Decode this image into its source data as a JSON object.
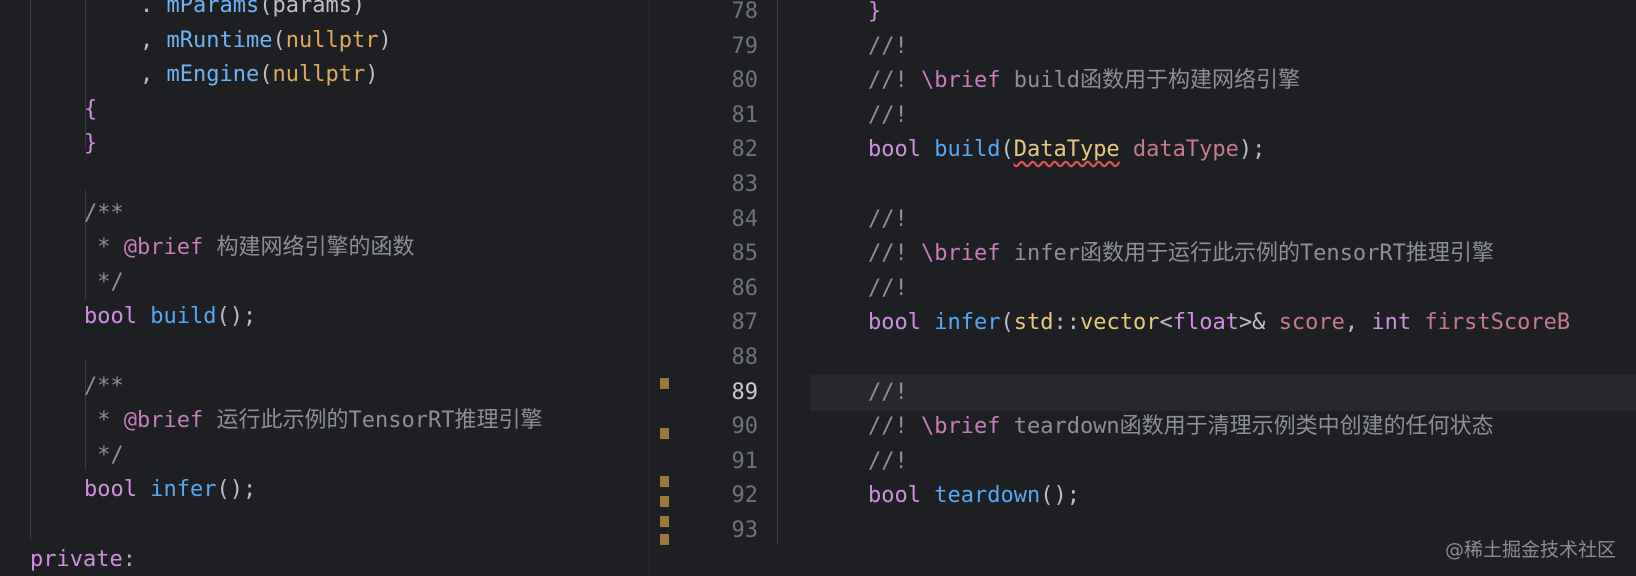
{
  "left": {
    "lines": [
      {
        "t": [
          [
            ". ",
            "punc"
          ],
          [
            "mParams",
            "prop"
          ],
          [
            "(params)",
            "punc"
          ]
        ]
      },
      {
        "t": [
          [
            ", ",
            "punc"
          ],
          [
            "mRuntime",
            "prop"
          ],
          [
            "(",
            "punc"
          ],
          [
            "nullptr",
            "lit"
          ],
          [
            ")",
            "punc"
          ]
        ]
      },
      {
        "t": [
          [
            ", ",
            "punc"
          ],
          [
            "mEngine",
            "prop"
          ],
          [
            "(",
            "punc"
          ],
          [
            "nullptr",
            "lit"
          ],
          [
            ")",
            "punc"
          ]
        ]
      },
      {
        "t": [
          [
            "{",
            "kw"
          ]
        ]
      },
      {
        "t": [
          [
            "}",
            "kw"
          ]
        ]
      },
      {
        "t": []
      },
      {
        "t": [
          [
            "/**",
            "cm"
          ]
        ]
      },
      {
        "t": [
          [
            " * ",
            "cm"
          ],
          [
            "@brief",
            "doctag"
          ],
          [
            " 构建网络引擎的函数",
            "cm"
          ]
        ]
      },
      {
        "t": [
          [
            " */",
            "cm"
          ]
        ]
      },
      {
        "t": [
          [
            "bool ",
            "kw"
          ],
          [
            "build",
            "fn"
          ],
          [
            "();",
            "punc"
          ]
        ]
      },
      {
        "t": []
      },
      {
        "t": [
          [
            "/**",
            "cm"
          ]
        ]
      },
      {
        "t": [
          [
            " * ",
            "cm"
          ],
          [
            "@brief",
            "doctag"
          ],
          [
            " 运行此示例的TensorRT推理引擎",
            "cm"
          ]
        ]
      },
      {
        "t": [
          [
            " */",
            "cm"
          ]
        ]
      },
      {
        "t": [
          [
            "bool ",
            "kw"
          ],
          [
            "infer",
            "fn"
          ],
          [
            "();",
            "punc"
          ]
        ]
      },
      {
        "t": []
      },
      {
        "t": [
          [
            "private:",
            "kw"
          ]
        ]
      }
    ]
  },
  "right": {
    "lines": [
      {
        "n": "78",
        "t": [
          [
            "}",
            "kw"
          ]
        ]
      },
      {
        "n": "79",
        "t": [
          [
            "//!",
            "cm"
          ]
        ]
      },
      {
        "n": "80",
        "t": [
          [
            "//! ",
            "cm"
          ],
          [
            "\\brief",
            "doctag"
          ],
          [
            " build函数用于构建网络引擎",
            "cm"
          ]
        ]
      },
      {
        "n": "81",
        "t": [
          [
            "//!",
            "cm"
          ]
        ]
      },
      {
        "n": "82",
        "t": [
          [
            "bool ",
            "kw"
          ],
          [
            "build",
            "fn"
          ],
          [
            "(",
            "punc"
          ],
          [
            "DataType",
            "type squiggle"
          ],
          [
            " dataType",
            "param"
          ],
          [
            ");",
            "punc"
          ]
        ]
      },
      {
        "n": "83",
        "t": []
      },
      {
        "n": "84",
        "t": [
          [
            "//!",
            "cm"
          ]
        ]
      },
      {
        "n": "85",
        "t": [
          [
            "//! ",
            "cm"
          ],
          [
            "\\brief",
            "doctag"
          ],
          [
            " infer函数用于运行此示例的TensorRT推理引擎",
            "cm"
          ]
        ]
      },
      {
        "n": "86",
        "t": [
          [
            "//!",
            "cm"
          ]
        ]
      },
      {
        "n": "87",
        "t": [
          [
            "bool ",
            "kw"
          ],
          [
            "infer",
            "fn"
          ],
          [
            "(",
            "punc"
          ],
          [
            "std",
            "type"
          ],
          [
            "::",
            "punc"
          ],
          [
            "vector",
            "type"
          ],
          [
            "<",
            "punc"
          ],
          [
            "float",
            "kw"
          ],
          [
            ">& ",
            "punc"
          ],
          [
            "score",
            "param"
          ],
          [
            ", ",
            "punc"
          ],
          [
            "int ",
            "kw"
          ],
          [
            "firstScoreB",
            "param"
          ]
        ]
      },
      {
        "n": "88",
        "t": []
      },
      {
        "n": "89",
        "t": [
          [
            "//!",
            "cm"
          ]
        ],
        "active": true
      },
      {
        "n": "90",
        "t": [
          [
            "//! ",
            "cm"
          ],
          [
            "\\brief",
            "doctag"
          ],
          [
            " teardown函数用于清理示例类中创建的任何状态",
            "cm"
          ]
        ]
      },
      {
        "n": "91",
        "t": [
          [
            "//!",
            "cm"
          ]
        ]
      },
      {
        "n": "92",
        "t": [
          [
            "bool ",
            "kw"
          ],
          [
            "teardown",
            "fn"
          ],
          [
            "();",
            "punc"
          ]
        ]
      },
      {
        "n": "93",
        "t": []
      }
    ]
  },
  "watermark": "@稀土掘金技术社区",
  "colors": {
    "background": "#1e1f22",
    "keyword": "#cf8ee0",
    "function": "#56a8f5",
    "comment": "#8c8f96"
  }
}
